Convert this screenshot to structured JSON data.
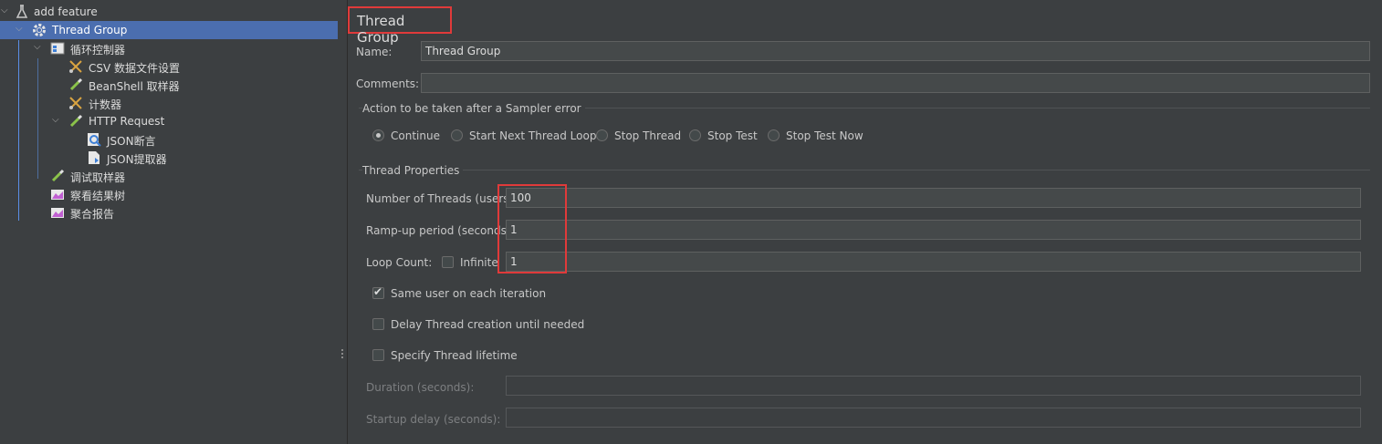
{
  "tree": {
    "items": [
      {
        "label": "add feature",
        "icon": "flask-icon"
      },
      {
        "label": "Thread Group",
        "icon": "gear-icon"
      },
      {
        "label": "循环控制器",
        "icon": "loop-controller-icon"
      },
      {
        "label": "CSV 数据文件设置",
        "icon": "scissors-config-icon"
      },
      {
        "label": "BeanShell 取样器",
        "icon": "pipette-icon"
      },
      {
        "label": "计数器",
        "icon": "scissors-config-icon"
      },
      {
        "label": "HTTP Request",
        "icon": "pipette-icon"
      },
      {
        "label": "JSON断言",
        "icon": "magnifier-icon"
      },
      {
        "label": "JSON提取器",
        "icon": "document-icon"
      },
      {
        "label": "调试取样器",
        "icon": "pipette-icon"
      },
      {
        "label": "察看结果树",
        "icon": "chart-icon"
      },
      {
        "label": "聚合报告",
        "icon": "chart-icon"
      }
    ]
  },
  "panel": {
    "title": "Thread Group",
    "name_label": "Name:",
    "name_value": "Thread Group",
    "comments_label": "Comments:",
    "comments_value": "",
    "sampler_error": {
      "title": "Action to be taken after a Sampler error",
      "options": [
        "Continue",
        "Start Next Thread Loop",
        "Stop Thread",
        "Stop Test",
        "Stop Test Now"
      ],
      "selected": "Continue"
    },
    "thread_props": {
      "title": "Thread Properties",
      "threads_label": "Number of Threads (users):",
      "threads_value": "100",
      "rampup_label": "Ramp-up period (seconds):",
      "rampup_value": "1",
      "loop_label": "Loop Count:",
      "infinite_label": "Infinite",
      "infinite_checked": false,
      "loop_value": "1",
      "same_user_label": "Same user on each iteration",
      "same_user_checked": true,
      "delay_label": "Delay Thread creation until needed",
      "delay_checked": false,
      "lifetime_label": "Specify Thread lifetime",
      "lifetime_checked": false,
      "duration_label": "Duration (seconds):",
      "duration_value": "",
      "startup_label": "Startup delay (seconds):",
      "startup_value": ""
    }
  },
  "colors": {
    "background": "#3c3f41",
    "selection": "#4b6eaf",
    "highlight": "#e03a3a"
  }
}
